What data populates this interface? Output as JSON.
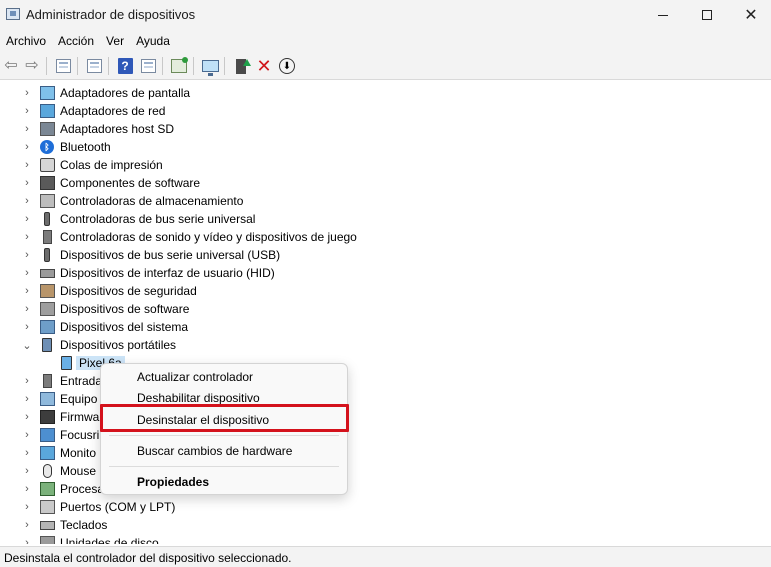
{
  "window": {
    "title": "Administrador de dispositivos",
    "minimize_icon": "minimize-icon",
    "maximize_icon": "maximize-icon",
    "close_icon": "close-icon"
  },
  "menu": {
    "items": [
      "Archivo",
      "Acción",
      "Ver",
      "Ayuda"
    ]
  },
  "toolbar": {
    "icons": [
      "back-arrow-icon",
      "forward-arrow-icon",
      "properties-view-icon",
      "details-icon",
      "help-icon",
      "properties-sheet-icon",
      "scan-hardware-icon",
      "monitor-icon",
      "add-driver-icon",
      "uninstall-x-icon",
      "update-driver-icon"
    ],
    "help_glyph": "?"
  },
  "tree": {
    "items": [
      {
        "label": "Adaptadores de pantalla",
        "icon": "display-adapter-icon"
      },
      {
        "label": "Adaptadores de red",
        "icon": "network-adapter-icon"
      },
      {
        "label": "Adaptadores host SD",
        "icon": "sd-host-icon"
      },
      {
        "label": "Bluetooth",
        "icon": "bluetooth-icon"
      },
      {
        "label": "Colas de impresión",
        "icon": "printer-icon"
      },
      {
        "label": "Componentes de software",
        "icon": "software-component-icon"
      },
      {
        "label": "Controladoras de almacenamiento",
        "icon": "storage-controller-icon"
      },
      {
        "label": "Controladoras de bus serie universal",
        "icon": "usb-controller-icon"
      },
      {
        "label": "Controladoras de sonido y vídeo y dispositivos de juego",
        "icon": "sound-icon"
      },
      {
        "label": "Dispositivos de bus serie universal (USB)",
        "icon": "usb-device-icon"
      },
      {
        "label": "Dispositivos de interfaz de usuario (HID)",
        "icon": "hid-icon"
      },
      {
        "label": "Dispositivos de seguridad",
        "icon": "security-device-icon"
      },
      {
        "label": "Dispositivos de software",
        "icon": "software-device-icon"
      },
      {
        "label": "Dispositivos del sistema",
        "icon": "system-device-icon"
      },
      {
        "label": "Dispositivos portátiles",
        "icon": "portable-device-icon"
      },
      {
        "label": "Pixel 6a",
        "icon": "phone-device-icon"
      },
      {
        "label": "Entrada",
        "icon": "audio-input-icon"
      },
      {
        "label": "Equipo",
        "icon": "computer-icon"
      },
      {
        "label": "Firmwa",
        "icon": "firmware-icon"
      },
      {
        "label": "Focusri",
        "icon": "focusrite-icon"
      },
      {
        "label": "Monito",
        "icon": "monitor-device-icon"
      },
      {
        "label": "Mouse",
        "icon": "mouse-icon"
      },
      {
        "label": "Procesa",
        "icon": "processor-icon"
      },
      {
        "label": "Puertos (COM y LPT)",
        "icon": "ports-icon"
      },
      {
        "label": "Teclados",
        "icon": "keyboard-icon"
      },
      {
        "label": "Unidades de disco",
        "icon": "disk-drive-icon"
      }
    ],
    "chevron_collapsed": "›",
    "chevron_expanded": "⌄"
  },
  "context_menu": {
    "update_driver": "Actualizar controlador",
    "disable_device": "Deshabilitar dispositivo",
    "uninstall_device": "Desinstalar el dispositivo",
    "scan_hardware": "Buscar cambios de hardware",
    "properties": "Propiedades",
    "highlight_color": "#d4121c"
  },
  "statusbar": {
    "text": "Desinstala el controlador del dispositivo seleccionado."
  }
}
